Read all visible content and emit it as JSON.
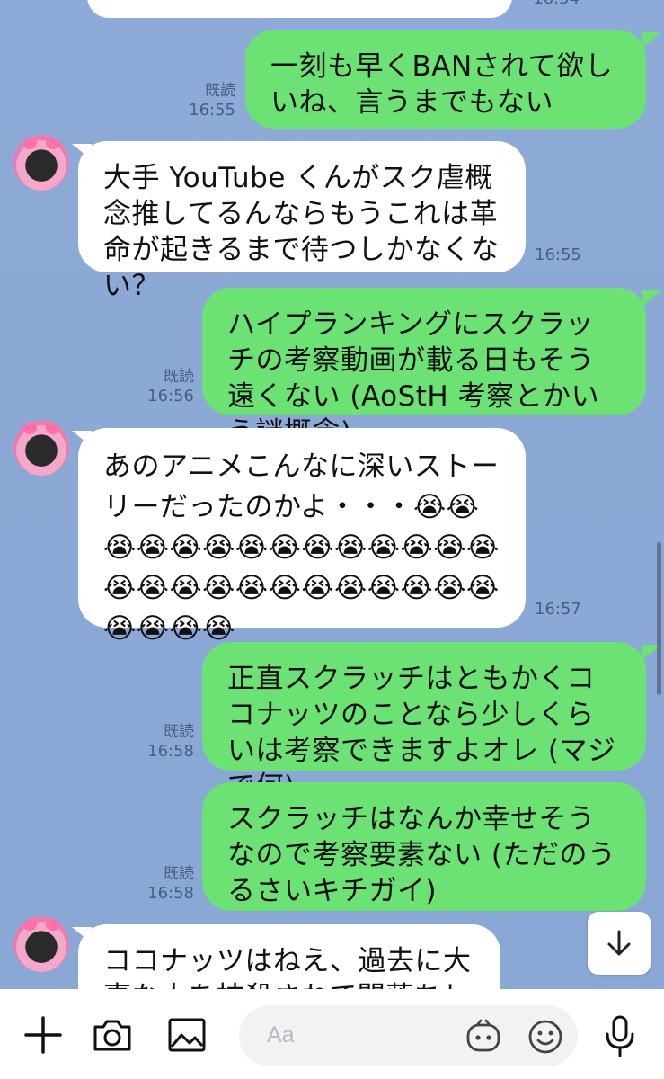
{
  "messages": [
    {
      "id": "m1",
      "side": "me",
      "text": "一刻も早くBANされて欲しいね、言うまでもない",
      "read": "既読",
      "time": "16:55"
    },
    {
      "id": "m2",
      "side": "them",
      "text": "大手 YouTube くんがスク虐概念推してるんならもうこれは革命が起きるまで待つしかなくない？",
      "time": "16:55"
    },
    {
      "id": "m3",
      "side": "me",
      "text": "ハイプランキングにスクラッチの考察動画が載る日もそう遠くない (AoStH 考察とかいう謎概念)",
      "read": "既読",
      "time": "16:56"
    },
    {
      "id": "m4",
      "side": "them",
      "text": "あのアニメこんなに深いストーリーだったのかよ・・・😭😭😭😭😭😭😭😭😭😭😭😭😭😭😭😭😭😭😭😭😭😭😭😭😭😭😭😭😭😭",
      "time": "16:57"
    },
    {
      "id": "m5",
      "side": "me",
      "text": "正直スクラッチはともかくココナッツのことなら少しくらいは考察できますよオレ (マジで何)",
      "read": "既読",
      "time": "16:58"
    },
    {
      "id": "m6",
      "side": "me",
      "text": "スクラッチはなんか幸せそうなので考察要素ない (ただのうるさいキチガイ)",
      "read": "既読",
      "time": "16:58"
    },
    {
      "id": "m7",
      "side": "them",
      "text": "ココナッツはねえ、過去に大事な人を抹殺されて闇落ちしてるか"
    }
  ],
  "top_partial_time": "16:54",
  "input": {
    "placeholder": "Aa"
  },
  "icons": {
    "plus": "plus-icon",
    "camera": "camera-icon",
    "image": "image-icon",
    "sticker": "sticker-icon",
    "emoji": "emoji-icon",
    "mic": "microphone-icon",
    "scroll_down": "arrow-down-icon"
  },
  "colors": {
    "my_bubble": "#6DE274",
    "their_bubble": "#FFFFFF",
    "chat_bg": "#8DABD8"
  }
}
